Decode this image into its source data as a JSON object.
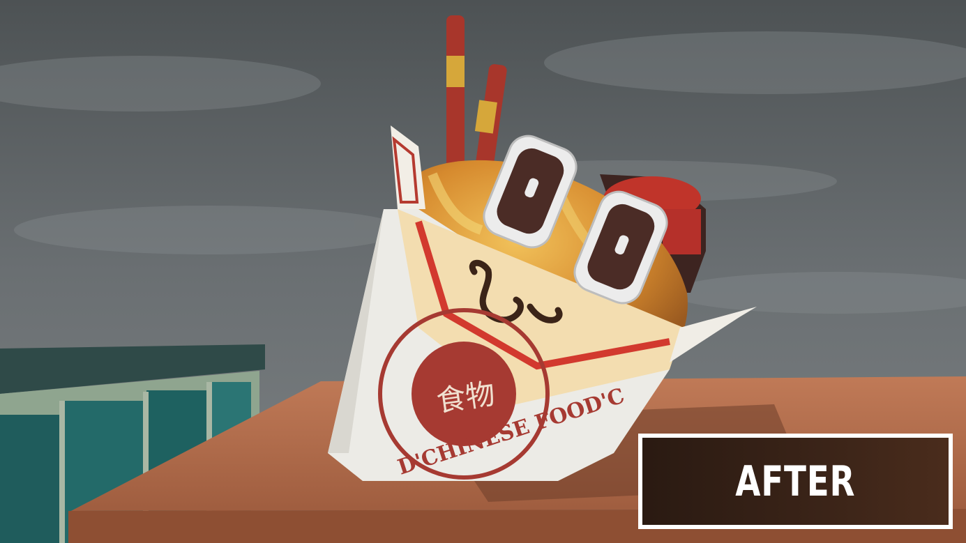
{
  "scene": {
    "description_free": true,
    "box_logo_text": "D'CHINESE FOOD'C",
    "box_logo_chinese": "食物"
  },
  "overlay": {
    "label": "AFTER"
  },
  "colors": {
    "sky": "#5d6264",
    "table_top": "#b5704f",
    "box_white": "#ecebe6",
    "logo_red": "#a63a32",
    "chopstick_red": "#a8362b",
    "label_bg": "#3b2418"
  }
}
